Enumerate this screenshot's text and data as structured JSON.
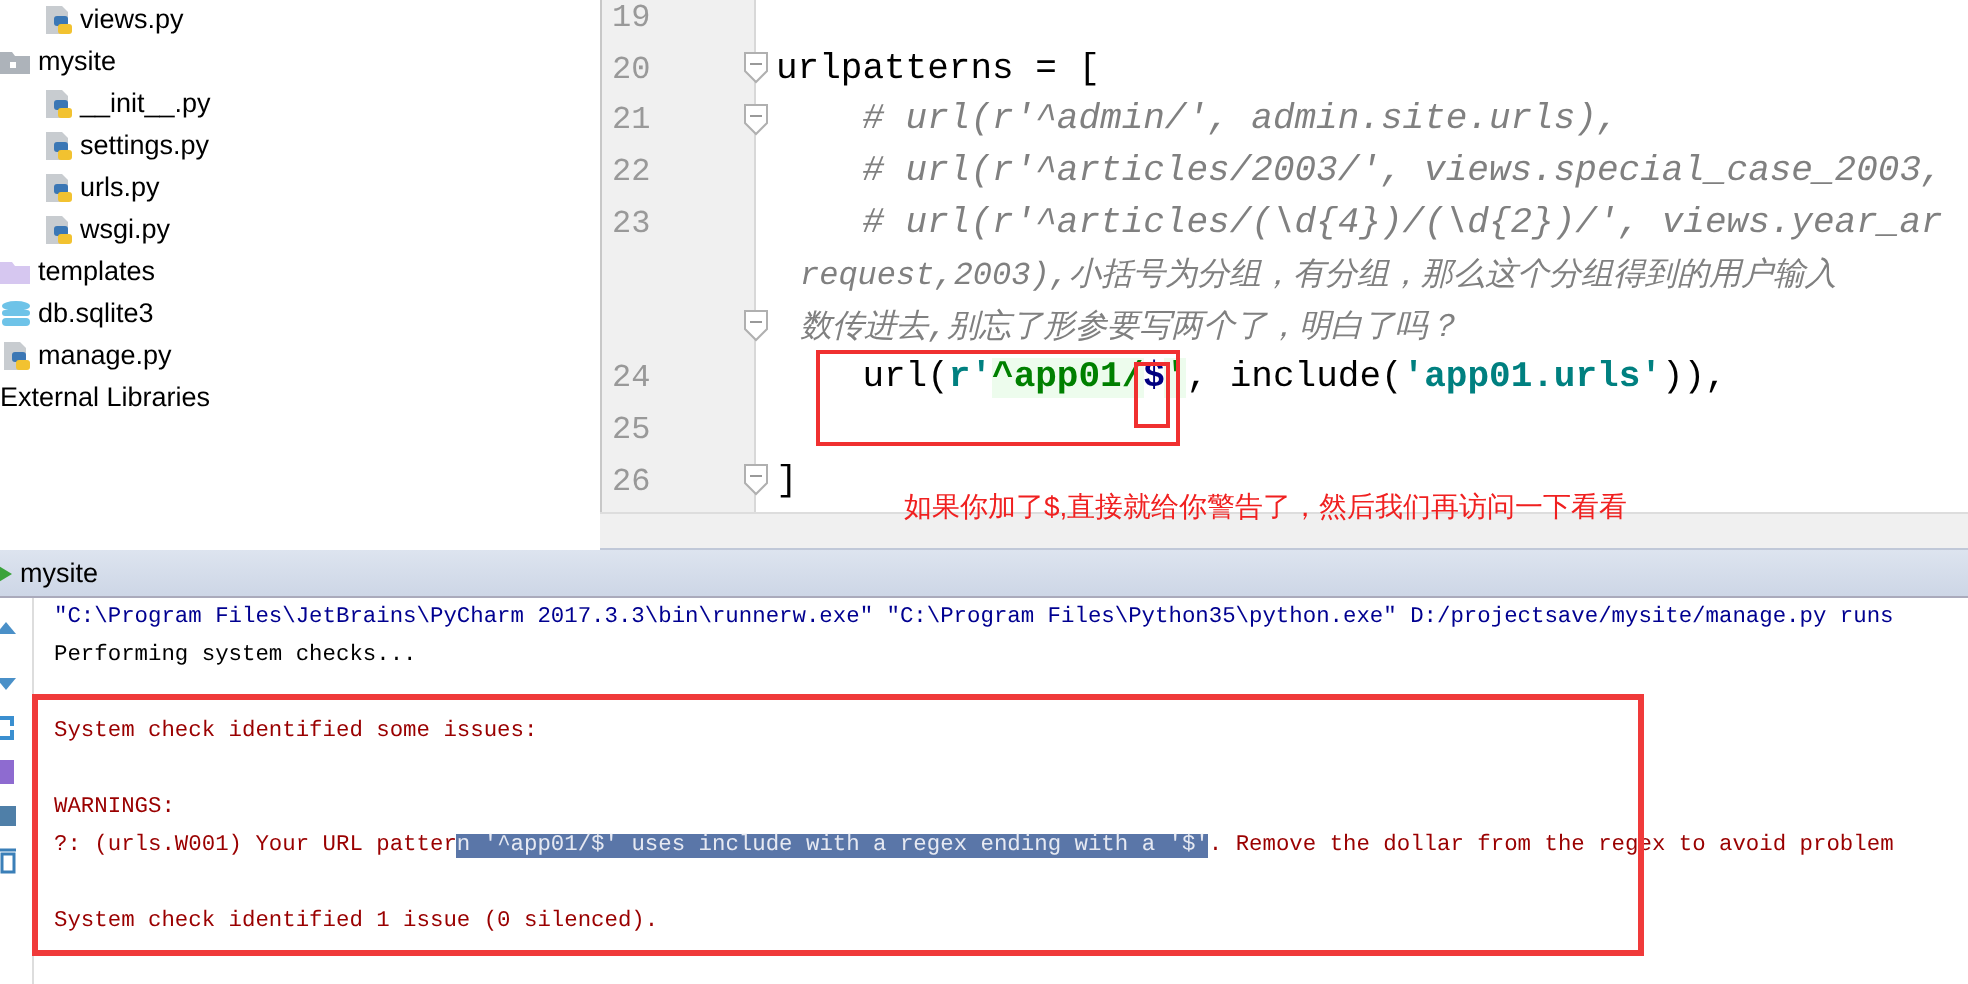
{
  "project_tree": [
    {
      "children": [
        {
          "label": "views.py",
          "kind": "python"
        }
      ]
    },
    {
      "label": "mysite",
      "kind": "package",
      "children": [
        {
          "label": "__init__.py",
          "kind": "python"
        },
        {
          "label": "settings.py",
          "kind": "python"
        },
        {
          "label": "urls.py",
          "kind": "python"
        },
        {
          "label": "wsgi.py",
          "kind": "python"
        }
      ]
    },
    {
      "label": "templates",
      "kind": "folder"
    },
    {
      "label": "db.sqlite3",
      "kind": "database"
    },
    {
      "label": "manage.py",
      "kind": "python"
    },
    {
      "label": "External Libraries",
      "kind": "libraries"
    }
  ],
  "editor": {
    "lines": [
      {
        "kind": "line",
        "number": "19",
        "fold": false
      },
      {
        "kind": "line",
        "number": "20",
        "fold": true,
        "tokens": [
          {
            "kind": "plain",
            "text": "urlpatterns = ["
          }
        ]
      },
      {
        "kind": "line",
        "number": "21",
        "fold": true,
        "tokens": [
          {
            "kind": "comment",
            "text": "    # url(r'^admin/', admin.site.urls),"
          }
        ]
      },
      {
        "kind": "line",
        "number": "22",
        "fold": false,
        "tokens": [
          {
            "kind": "comment",
            "text": "    # url(r'^articles/2003/', views.special_case_2003,"
          }
        ]
      },
      {
        "kind": "line",
        "number": "23",
        "fold": false,
        "tokens": [
          {
            "kind": "comment",
            "text": "    # url(r'^articles/(\\d{4})/(\\d{2})/', views.year_ar"
          }
        ]
      },
      {
        "kind": "wrap",
        "fold": false,
        "tokens": [
          {
            "kind": "comment",
            "text": "request,2003),小括号为分组，有分组，那么这个分组得到的用户输入"
          }
        ]
      },
      {
        "kind": "wrap",
        "fold": true,
        "tokens": [
          {
            "kind": "comment",
            "text": "数传进去,别忘了形参要写两个了，明白了吗？"
          }
        ]
      },
      {
        "kind": "line",
        "number": "24",
        "fold": false,
        "tokens": [
          {
            "kind": "plain",
            "text": "    url("
          },
          {
            "kind": "string",
            "text": "r'"
          },
          {
            "kind": "regex",
            "text": "^app01/"
          },
          {
            "kind": "special",
            "text": "$"
          },
          {
            "kind": "regex",
            "text": "'"
          },
          {
            "kind": "plain",
            "text": ", include("
          },
          {
            "kind": "string",
            "text": "'app01.urls'"
          },
          {
            "kind": "plain",
            "text": ")),"
          }
        ]
      },
      {
        "kind": "line",
        "number": "25",
        "fold": false
      },
      {
        "kind": "line",
        "number": "26",
        "fold": true,
        "tokens": [
          {
            "kind": "plain",
            "text": "]"
          }
        ]
      }
    ],
    "note": "如果你加了$,直接就给你警告了，然后我们再访问一下看看"
  },
  "run_panel": {
    "title": "mysite",
    "lines": [
      {
        "kind": "command",
        "segments": [
          {
            "text": "\"C:\\Program Files\\JetBrains\\PyCharm 2017.3.3\\bin\\runnerw.exe\" \"C:\\Program Files\\Python35\\python.exe\" D:/projectsave/mysite/manage.py runs",
            "selected": false
          }
        ]
      },
      {
        "kind": "info",
        "segments": [
          {
            "text": "Performing system checks...",
            "selected": false
          }
        ]
      },
      {
        "kind": "blank"
      },
      {
        "kind": "error",
        "segments": [
          {
            "text": "System check identified some issues:",
            "selected": false
          }
        ]
      },
      {
        "kind": "blank"
      },
      {
        "kind": "error",
        "segments": [
          {
            "text": "WARNINGS:",
            "selected": false
          }
        ]
      },
      {
        "kind": "error",
        "segments": [
          {
            "text": "?: (urls.W001) Your URL patter",
            "selected": false
          },
          {
            "text": "n '^app01/$' uses include with a regex ending with a '$'",
            "selected": true
          },
          {
            "text": ". Remove the dollar from the regex to avoid problem",
            "selected": false
          }
        ]
      },
      {
        "kind": "blank"
      },
      {
        "kind": "error",
        "segments": [
          {
            "text": "System check identified 1 issue (0 silenced).",
            "selected": false
          }
        ]
      }
    ]
  }
}
